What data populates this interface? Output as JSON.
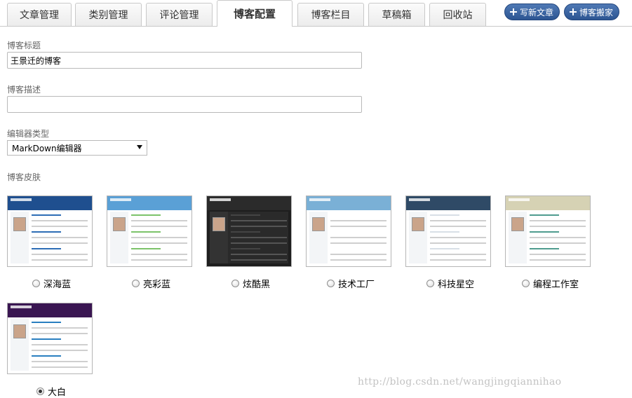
{
  "tabs": [
    {
      "label": "文章管理",
      "active": false
    },
    {
      "label": "类别管理",
      "active": false
    },
    {
      "label": "评论管理",
      "active": false
    },
    {
      "label": "博客配置",
      "active": true
    },
    {
      "label": "博客栏目",
      "active": false
    },
    {
      "label": "草稿箱",
      "active": false
    },
    {
      "label": "回收站",
      "active": false
    }
  ],
  "actions": {
    "write_article": {
      "label": "写新文章",
      "icon": "plus-icon"
    },
    "blog_move": {
      "label": "博客搬家",
      "icon": "plus-icon"
    }
  },
  "form": {
    "title_label": "博客标题",
    "title_value": "王景迁的博客",
    "desc_label": "博客描述",
    "desc_value": "",
    "editor_label": "编辑器类型",
    "editor_selected": "MarkDown编辑器",
    "skin_label": "博客皮肤"
  },
  "skins": [
    {
      "name": "深海蓝",
      "checked": false,
      "header_color": "#1f4f8f",
      "accent": "#2d6db5",
      "theme": "light"
    },
    {
      "name": "亮彩蓝",
      "checked": false,
      "header_color": "#5aa0d6",
      "accent": "#7cc36a",
      "theme": "light"
    },
    {
      "name": "炫酷黑",
      "checked": false,
      "header_color": "#2b2b2b",
      "accent": "#444444",
      "theme": "dark"
    },
    {
      "name": "技术工厂",
      "checked": false,
      "header_color": "#7ab0d6",
      "accent": "#ffffff",
      "theme": "light"
    },
    {
      "name": "科技星空",
      "checked": false,
      "header_color": "#2f4a66",
      "accent": "#d8dfe6",
      "theme": "light"
    },
    {
      "name": "编程工作室",
      "checked": false,
      "header_color": "#d6d2b4",
      "accent": "#4f9c8f",
      "theme": "light"
    },
    {
      "name": "大白",
      "checked": true,
      "header_color": "#3a1652",
      "accent": "#2a7fc0",
      "theme": "white"
    }
  ],
  "watermark": "http://blog.csdn.net/wangjingqiannihao"
}
